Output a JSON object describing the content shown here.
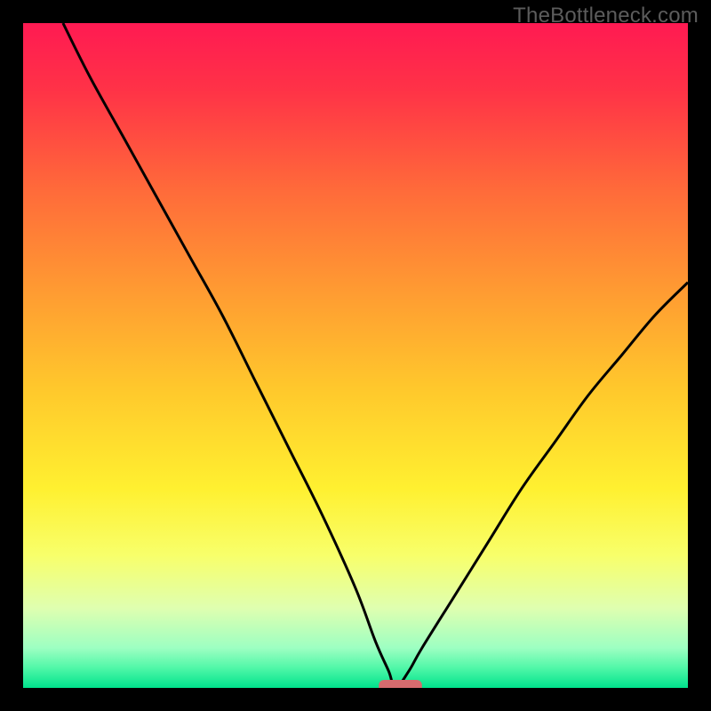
{
  "watermark": "TheBottleneck.com",
  "colors": {
    "frame": "#000000",
    "curve": "#000000",
    "marker_fill": "#d66b6e",
    "gradient_stops": [
      {
        "offset": 0.0,
        "color": "#ff1a52"
      },
      {
        "offset": 0.1,
        "color": "#ff3247"
      },
      {
        "offset": 0.25,
        "color": "#ff6a3a"
      },
      {
        "offset": 0.4,
        "color": "#ff9a32"
      },
      {
        "offset": 0.55,
        "color": "#ffc82c"
      },
      {
        "offset": 0.7,
        "color": "#fff030"
      },
      {
        "offset": 0.8,
        "color": "#f8ff6a"
      },
      {
        "offset": 0.88,
        "color": "#dfffb0"
      },
      {
        "offset": 0.94,
        "color": "#9dffc2"
      },
      {
        "offset": 0.97,
        "color": "#50f7a8"
      },
      {
        "offset": 1.0,
        "color": "#00e28c"
      }
    ]
  },
  "chart_data": {
    "type": "line",
    "title": "",
    "xlabel": "",
    "ylabel": "",
    "x_range": [
      0,
      100
    ],
    "y_range": [
      0,
      100
    ],
    "optimum_x": 56,
    "marker": {
      "x_start": 53.5,
      "x_end": 60,
      "y": 0,
      "thickness": 2.2
    },
    "series": [
      {
        "name": "bottleneck-curve",
        "x": [
          6,
          10,
          15,
          20,
          25,
          30,
          35,
          40,
          45,
          50,
          53,
          55,
          56,
          58,
          60,
          65,
          70,
          75,
          80,
          85,
          90,
          95,
          100
        ],
        "y": [
          100,
          92,
          83,
          74,
          65,
          56,
          46,
          36,
          26,
          15,
          7,
          2.5,
          0,
          2.5,
          6,
          14,
          22,
          30,
          37,
          44,
          50,
          56,
          61
        ]
      }
    ]
  }
}
